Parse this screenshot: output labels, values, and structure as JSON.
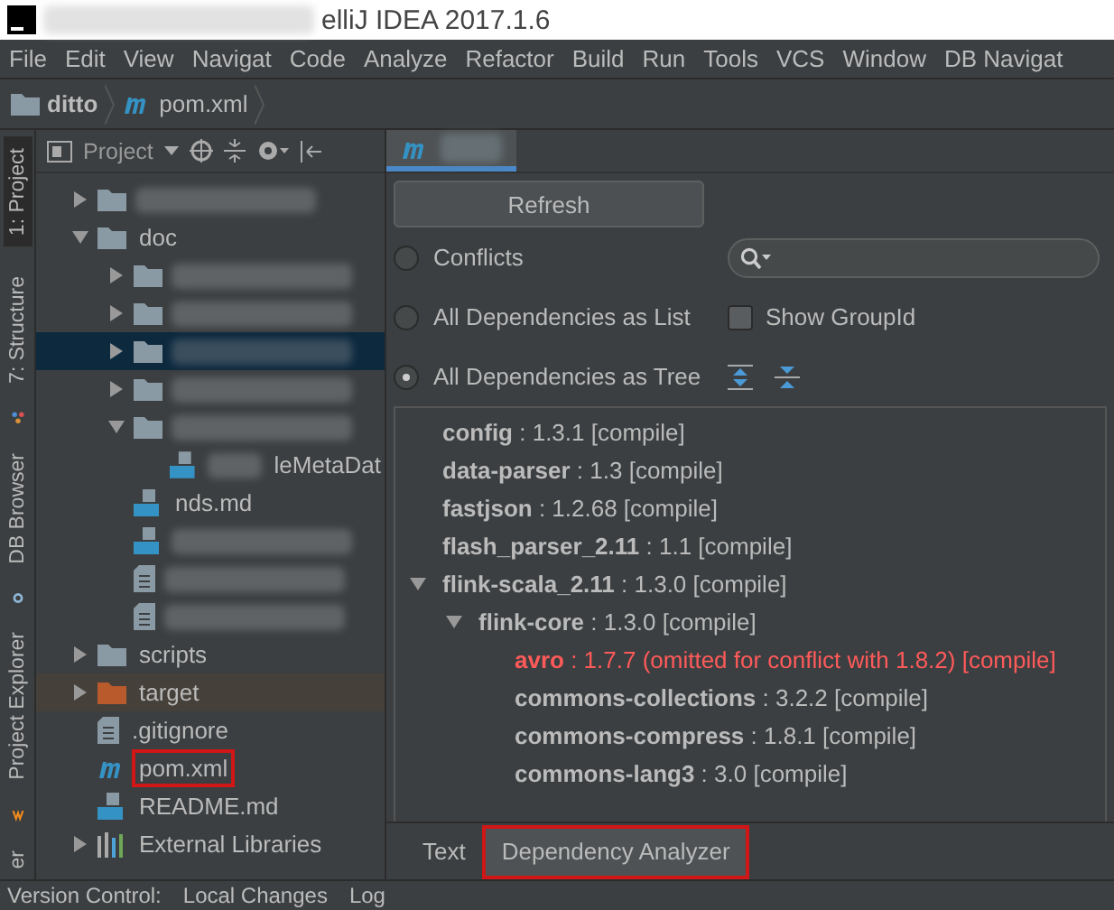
{
  "window": {
    "title": "elliJ IDEA 2017.1.6"
  },
  "menu": [
    "File",
    "Edit",
    "View",
    "Navigat",
    "Code",
    "Analyze",
    "Refactor",
    "Build",
    "Run",
    "Tools",
    "VCS",
    "Window",
    "DB Navigat"
  ],
  "breadcrumb": [
    {
      "kind": "folder",
      "label": "ditto"
    },
    {
      "kind": "maven",
      "label": "pom.xml"
    }
  ],
  "side_tabs": [
    {
      "label": "1: Project",
      "selected": true,
      "kind": "project"
    },
    {
      "label": "7: Structure",
      "selected": false,
      "kind": "structure"
    },
    {
      "label": "DB Browser",
      "selected": false,
      "kind": "db"
    },
    {
      "label": "Project Explorer",
      "selected": false,
      "kind": "explorer"
    },
    {
      "label": "er",
      "selected": false,
      "kind": "plain"
    }
  ],
  "project_panel": {
    "title": "Project"
  },
  "project_tree": [
    {
      "kind": "folder",
      "expanded": false,
      "selected": false
    },
    {
      "kind": "folder",
      "label": "doc",
      "expanded": true,
      "selected": false,
      "children": [
        {
          "kind": "folder",
          "expanded": false,
          "selected": false
        },
        {
          "kind": "folder",
          "expanded": false,
          "selected": false
        },
        {
          "kind": "folder",
          "expanded": false,
          "selected": true
        },
        {
          "kind": "folder",
          "expanded": false,
          "selected": false
        },
        {
          "kind": "folder",
          "expanded": true,
          "selected": false,
          "children": [
            {
              "kind": "md",
              "label": "leMetaDat",
              "selected": false
            }
          ]
        },
        {
          "kind": "md",
          "label": "nds.md",
          "selected": false
        },
        {
          "kind": "json",
          "selected": false
        },
        {
          "kind": "text",
          "selected": false
        },
        {
          "kind": "text",
          "selected": false
        }
      ]
    },
    {
      "kind": "folder",
      "label": "scripts",
      "expanded": false,
      "selected": false
    },
    {
      "kind": "target",
      "label": "target",
      "expanded": false,
      "selected": false
    },
    {
      "kind": "text",
      "label": ".gitignore",
      "selected": false
    },
    {
      "kind": "maven",
      "label": "pom.xml",
      "selected": false,
      "highlighted": true
    },
    {
      "kind": "md",
      "label": "README.md",
      "selected": false
    },
    {
      "kind": "libraries",
      "label": "External Libraries",
      "expanded": false,
      "selected": false
    }
  ],
  "analyzer": {
    "refresh": "Refresh",
    "modes": [
      {
        "label": "Conflicts",
        "selected": false
      },
      {
        "label": "All Dependencies as List",
        "selected": false
      },
      {
        "label": "All Dependencies as Tree",
        "selected": true
      }
    ],
    "show_group_id": {
      "label": "Show GroupId",
      "checked": false
    },
    "dependencies": [
      {
        "name": "config",
        "detail": " : 1.3.1 [compile]",
        "conflict": false
      },
      {
        "name": "data-parser",
        "detail": " : 1.3 [compile]",
        "conflict": false
      },
      {
        "name": "fastjson",
        "detail": " : 1.2.68 [compile]",
        "conflict": false
      },
      {
        "name": "flash_parser_2.11",
        "detail": " : 1.1 [compile]",
        "conflict": false
      },
      {
        "name": "flink-scala_2.11",
        "detail": " : 1.3.0 [compile]",
        "conflict": false,
        "expanded": true,
        "children": [
          {
            "name": "flink-core",
            "detail": " : 1.3.0 [compile]",
            "conflict": false,
            "expanded": true,
            "children": [
              {
                "name": "avro",
                "detail": " : 1.7.7 (omitted for conflict with 1.8.2) [compile]",
                "conflict": true
              },
              {
                "name": "commons-collections",
                "detail": " : 3.2.2 [compile]",
                "conflict": false
              },
              {
                "name": "commons-compress",
                "detail": " : 1.8.1 [compile]",
                "conflict": false
              },
              {
                "name": "commons-lang3",
                "detail": " : 3.0 [compile]",
                "conflict": false
              }
            ]
          }
        ]
      }
    ]
  },
  "editor_tabs": [
    {
      "label": "Text",
      "selected": false,
      "highlighted": false
    },
    {
      "label": "Dependency Analyzer",
      "selected": true,
      "highlighted": true
    }
  ],
  "status_bar": [
    "Version Control:",
    "Local Changes",
    "Log"
  ]
}
